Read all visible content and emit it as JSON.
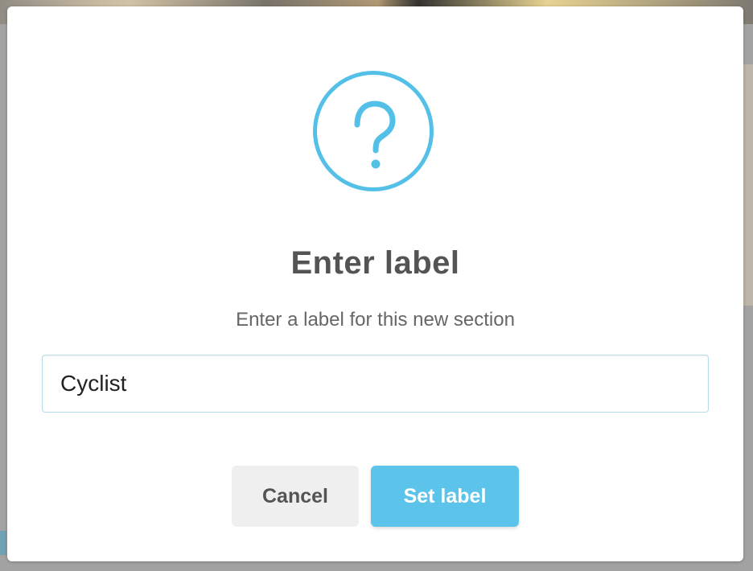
{
  "dialog": {
    "icon": "question-mark-circle-icon",
    "title": "Enter label",
    "subtitle": "Enter a label for this new section",
    "input": {
      "value": "Cyclist",
      "placeholder": ""
    },
    "buttons": {
      "cancel_label": "Cancel",
      "confirm_label": "Set label"
    }
  },
  "colors": {
    "accent": "#54c0e8",
    "confirm_button": "#5cc3ea",
    "cancel_button": "#efefef",
    "title_text": "#545454"
  }
}
